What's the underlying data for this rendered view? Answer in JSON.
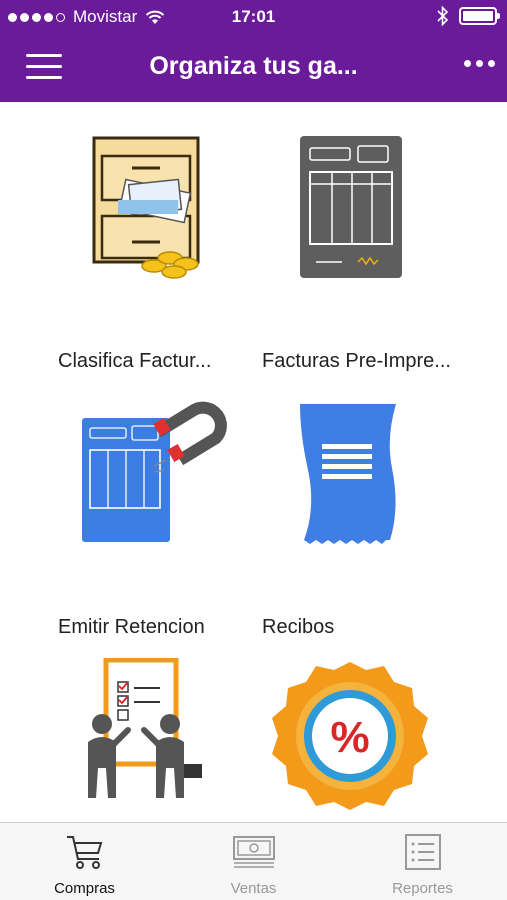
{
  "status_bar": {
    "carrier": "Movistar",
    "time": "17:01"
  },
  "header": {
    "title": "Organiza tus ga..."
  },
  "tiles": [
    {
      "label": "Clasifica Factur...",
      "icon": "file-cabinet-icon"
    },
    {
      "label": "Facturas Pre-Impre...",
      "icon": "preprinted-invoice-icon"
    },
    {
      "label": "Emitir Retencion",
      "icon": "withholding-magnet-icon"
    },
    {
      "label": "Recibos",
      "icon": "receipt-icon"
    },
    {
      "label": "",
      "icon": "team-checklist-icon"
    },
    {
      "label": "",
      "icon": "percent-badge-icon"
    }
  ],
  "tabs": [
    {
      "label": "Compras",
      "icon": "cart-icon",
      "active": true
    },
    {
      "label": "Ventas",
      "icon": "banknote-icon",
      "active": false
    },
    {
      "label": "Reportes",
      "icon": "list-report-icon",
      "active": false
    }
  ],
  "colors": {
    "header": "#6a1b9a",
    "tab_inactive": "#999999",
    "tab_active": "#111111"
  }
}
